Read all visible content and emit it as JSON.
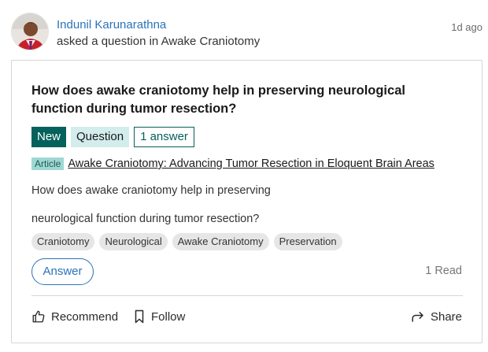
{
  "post": {
    "author": "Indunil Karunarathna",
    "action_text": "asked a question in Awake Craniotomy",
    "time": "1d ago",
    "avatar_icon": "user-avatar"
  },
  "question": {
    "title": "How does awake craniotomy help in preserving neurological function during tumor resection?",
    "badges": {
      "new": "New",
      "type": "Question",
      "answers": "1 answer"
    },
    "article": {
      "tag": "Article",
      "link_text": "Awake Craniotomy: Advancing Tumor Resection in Eloquent Brain Areas"
    },
    "body_lines": [
      "How does awake craniotomy help in preserving",
      "neurological function during tumor resection?"
    ],
    "topics": [
      "Craniotomy",
      "Neurological",
      "Awake Craniotomy",
      "Preservation"
    ],
    "answer_button": "Answer",
    "reads": "1 Read"
  },
  "actions": {
    "recommend": "Recommend",
    "follow": "Follow",
    "share": "Share"
  },
  "colors": {
    "link_blue": "#2b73b9",
    "teal_dark": "#04615b",
    "teal_light": "#d3ecec",
    "article_tag": "#9fd7d3"
  }
}
